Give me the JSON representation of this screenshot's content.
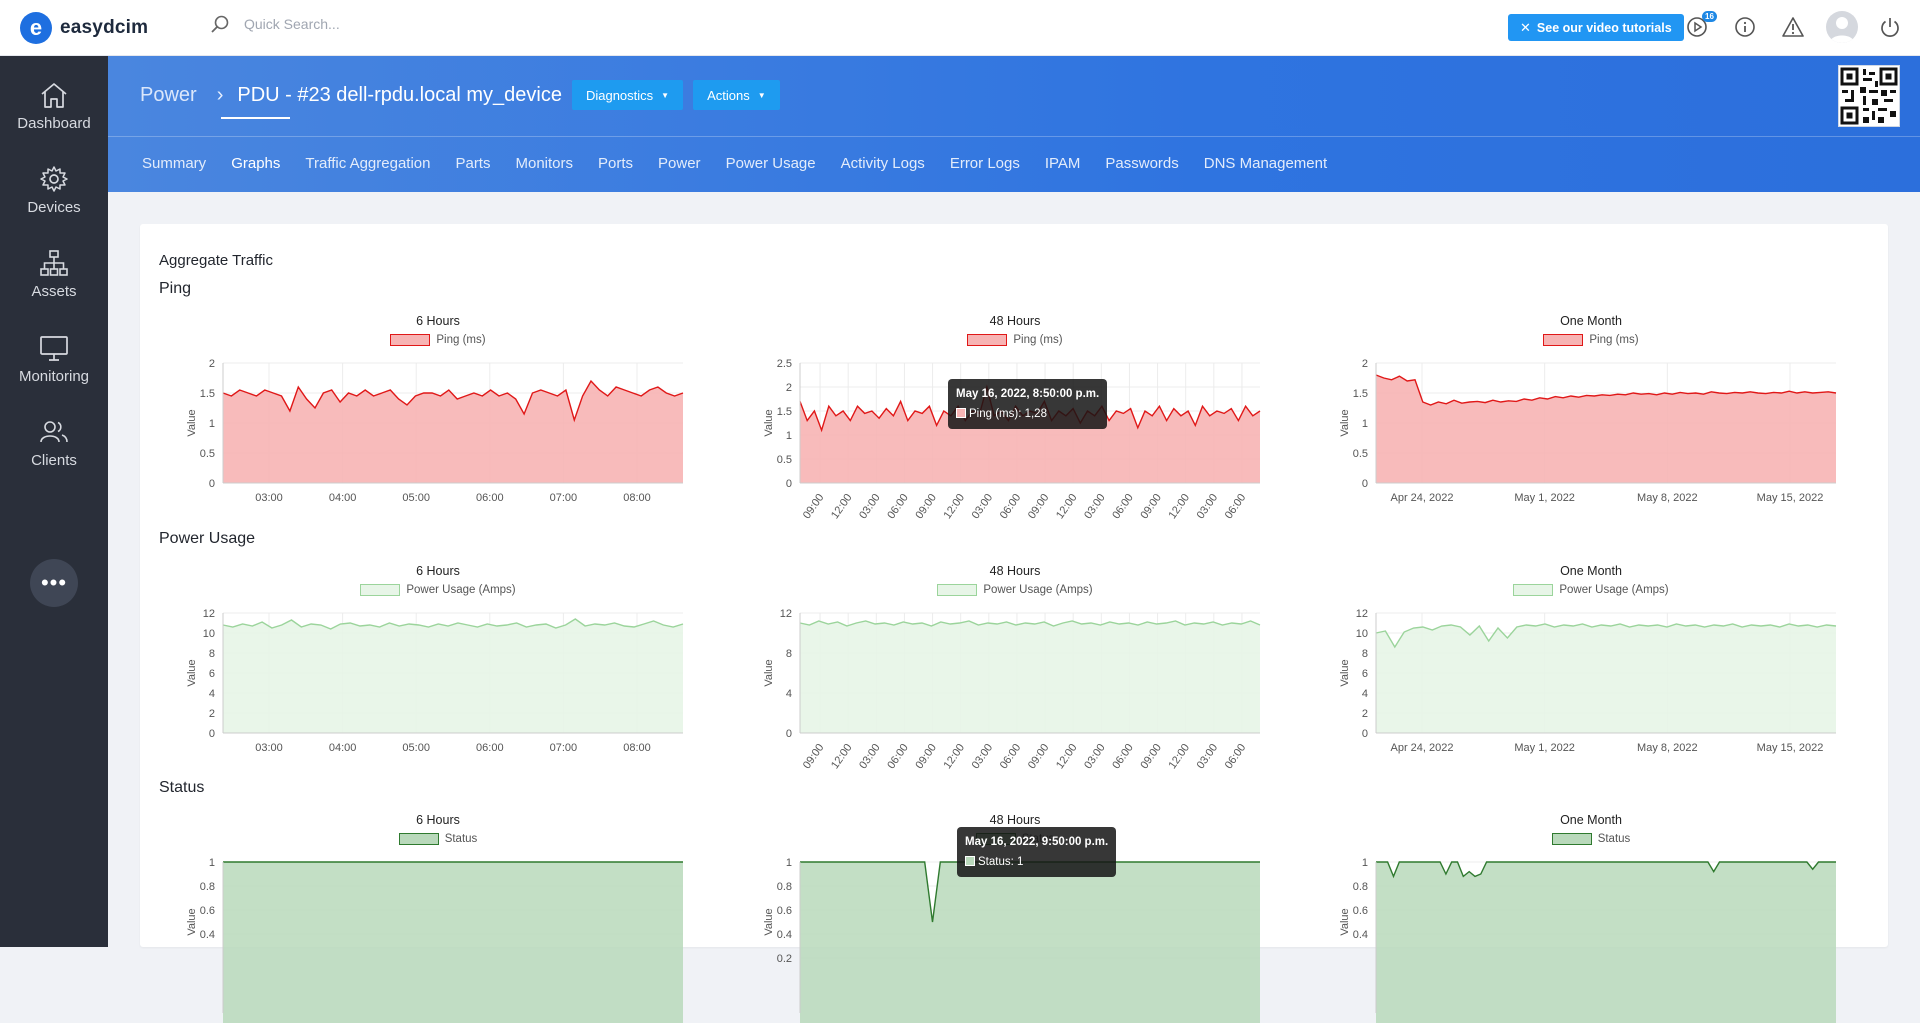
{
  "app": {
    "name": "easydcim"
  },
  "search": {
    "placeholder": "Quick Search..."
  },
  "topbar": {
    "tutorial_label": "See our video tutorials",
    "notification_count": "16"
  },
  "sidebar": {
    "items": [
      {
        "label": "Dashboard",
        "icon": "home-icon"
      },
      {
        "label": "Devices",
        "icon": "gear-icon"
      },
      {
        "label": "Assets",
        "icon": "sitemap-icon"
      },
      {
        "label": "Monitoring",
        "icon": "monitor-icon"
      },
      {
        "label": "Clients",
        "icon": "users-icon"
      }
    ],
    "more_label": "•••"
  },
  "header": {
    "breadcrumb_root": "Power",
    "title": "PDU - #23 dell-rpdu.local my_device",
    "diagnostics_label": "Diagnostics",
    "actions_label": "Actions",
    "tabs": [
      "Summary",
      "Graphs",
      "Traffic Aggregation",
      "Parts",
      "Monitors",
      "Ports",
      "Power",
      "Power Usage",
      "Activity Logs",
      "Error Logs",
      "IPAM",
      "Passwords",
      "DNS Management"
    ],
    "active_tab": "Graphs"
  },
  "content": {
    "aggregate_label": "Aggregate Traffic",
    "sections": [
      "Ping",
      "Power Usage",
      "Status"
    ]
  },
  "colors": {
    "ping_line": "#e01818",
    "ping_fill": "#f7b4b4",
    "power_line": "#9bd49b",
    "power_fill": "#e7f5e7",
    "status_line": "#2f7a2f",
    "status_fill": "#b9d9bb",
    "accent": "#2f74e0"
  },
  "chart_data": [
    {
      "type": "area",
      "section": "Ping",
      "title": "6 Hours",
      "series_name": "Ping (ms)",
      "ylabel": "Value",
      "ylim": [
        0,
        2
      ],
      "yticks": [
        "2",
        "1.5",
        "1",
        "0.5",
        "0"
      ],
      "xticks": [
        "03:00",
        "04:00",
        "05:00",
        "06:00",
        "07:00",
        "08:00"
      ],
      "values": [
        1.5,
        1.45,
        1.55,
        1.5,
        1.45,
        1.55,
        1.5,
        1.45,
        1.2,
        1.6,
        1.4,
        1.25,
        1.5,
        1.55,
        1.35,
        1.5,
        1.45,
        1.55,
        1.45,
        1.5,
        1.55,
        1.4,
        1.3,
        1.45,
        1.5,
        1.5,
        1.45,
        1.55,
        1.4,
        1.45,
        1.5,
        1.45,
        1.55,
        1.45,
        1.5,
        1.4,
        1.15,
        1.5,
        1.55,
        1.5,
        1.45,
        1.55,
        1.05,
        1.45,
        1.7,
        1.55,
        1.45,
        1.6,
        1.55,
        1.5,
        1.45,
        1.55,
        1.6,
        1.5,
        1.45,
        1.5
      ]
    },
    {
      "type": "area",
      "section": "Ping",
      "title": "48 Hours",
      "series_name": "Ping (ms)",
      "ylabel": "Value",
      "ylim": [
        0,
        2.5
      ],
      "yticks": [
        "2.5",
        "2",
        "1.5",
        "1",
        "0.5",
        "0"
      ],
      "xticks": [
        "09:00",
        "12:00",
        "03:00",
        "06:00",
        "09:00",
        "12:00",
        "03:00",
        "06:00",
        "09:00",
        "12:00",
        "03:00",
        "06:00",
        "09:00",
        "12:00",
        "03:00",
        "06:00"
      ],
      "values": [
        1.7,
        1.3,
        1.5,
        1.1,
        1.6,
        1.4,
        1.5,
        1.3,
        1.6,
        1.45,
        1.5,
        1.35,
        1.55,
        1.4,
        1.7,
        1.3,
        1.5,
        1.45,
        1.6,
        1.2,
        1.5,
        1.4,
        1.6,
        1.3,
        1.5,
        1.45,
        2.0,
        1.4,
        1.5,
        1.3,
        1.6,
        1.4,
        1.5,
        1.45,
        1.7,
        1.3,
        1.5,
        1.4,
        1.55,
        1.25,
        1.5,
        1.4,
        1.6,
        1.3,
        1.5,
        1.45,
        1.55,
        1.15,
        1.5,
        1.4,
        1.6,
        1.3,
        1.55,
        1.4,
        1.5,
        1.2,
        1.6,
        1.4,
        1.5,
        1.45,
        1.55,
        1.3,
        1.6,
        1.4,
        1.5
      ],
      "tooltip": {
        "date": "May 16, 2022, 8:50:00 p.m.",
        "text": "Ping (ms): 1,28"
      }
    },
    {
      "type": "area",
      "section": "Ping",
      "title": "One Month",
      "series_name": "Ping (ms)",
      "ylabel": "Value",
      "ylim": [
        0,
        2
      ],
      "yticks": [
        "2",
        "1.5",
        "1",
        "0.5",
        "0"
      ],
      "xticks": [
        "Apr 24, 2022",
        "May 1, 2022",
        "May 8, 2022",
        "May 15, 2022"
      ],
      "values": [
        1.8,
        1.75,
        1.72,
        1.78,
        1.7,
        1.72,
        1.35,
        1.3,
        1.35,
        1.32,
        1.38,
        1.33,
        1.35,
        1.36,
        1.34,
        1.38,
        1.35,
        1.37,
        1.36,
        1.4,
        1.38,
        1.42,
        1.4,
        1.44,
        1.42,
        1.45,
        1.43,
        1.46,
        1.45,
        1.47,
        1.46,
        1.48,
        1.47,
        1.5,
        1.48,
        1.49,
        1.47,
        1.5,
        1.48,
        1.51,
        1.49,
        1.5,
        1.48,
        1.52,
        1.5,
        1.49,
        1.51,
        1.5,
        1.52,
        1.5,
        1.49,
        1.51,
        1.5,
        1.53,
        1.5,
        1.52,
        1.5,
        1.51,
        1.52,
        1.5
      ]
    },
    {
      "type": "area",
      "section": "Power Usage",
      "title": "6 Hours",
      "series_name": "Power Usage (Amps)",
      "ylabel": "Value",
      "ylim": [
        0,
        12
      ],
      "yticks": [
        "12",
        "10",
        "8",
        "6",
        "4",
        "2",
        "0"
      ],
      "xticks": [
        "03:00",
        "04:00",
        "05:00",
        "06:00",
        "07:00",
        "08:00"
      ],
      "values": [
        10.8,
        10.6,
        10.9,
        10.7,
        11.1,
        10.5,
        10.8,
        11.3,
        10.6,
        10.9,
        10.8,
        10.4,
        10.9,
        11.0,
        10.7,
        10.8,
        10.6,
        11.0,
        10.7,
        10.9,
        10.8,
        10.6,
        10.9,
        10.7,
        11.0,
        10.8,
        10.6,
        10.9,
        10.7,
        10.8,
        11.0,
        10.6,
        10.8,
        10.9,
        10.5,
        10.8,
        11.4,
        10.7,
        10.9,
        10.8,
        11.0,
        10.7,
        10.6,
        10.9,
        11.2,
        10.8,
        10.6,
        10.9
      ]
    },
    {
      "type": "area",
      "section": "Power Usage",
      "title": "48 Hours",
      "series_name": "Power Usage (Amps)",
      "ylabel": "Value",
      "ylim": [
        0,
        12
      ],
      "yticks": [
        "12",
        "8",
        "4",
        "0"
      ],
      "xticks": [
        "09:00",
        "12:00",
        "03:00",
        "06:00",
        "09:00",
        "12:00",
        "03:00",
        "06:00",
        "09:00",
        "12:00",
        "03:00",
        "06:00",
        "09:00",
        "12:00",
        "03:00",
        "06:00"
      ],
      "values": [
        11.0,
        10.8,
        11.2,
        10.9,
        11.1,
        10.7,
        11.0,
        11.2,
        10.9,
        11.0,
        10.8,
        11.1,
        10.9,
        11.0,
        10.7,
        11.1,
        10.9,
        11.0,
        11.2,
        10.8,
        11.0,
        10.9,
        11.1,
        10.8,
        11.0,
        10.9,
        11.1,
        10.7,
        11.0,
        11.2,
        10.9,
        11.0,
        10.8,
        11.1,
        10.9,
        11.0,
        10.8,
        11.1,
        10.9,
        11.0,
        11.2,
        10.8,
        11.0,
        10.9,
        11.1,
        10.8,
        11.0,
        10.9,
        11.2,
        10.8
      ]
    },
    {
      "type": "area",
      "section": "Power Usage",
      "title": "One Month",
      "series_name": "Power Usage (Amps)",
      "ylabel": "Value",
      "ylim": [
        0,
        12
      ],
      "yticks": [
        "12",
        "10",
        "8",
        "6",
        "4",
        "2",
        "0"
      ],
      "xticks": [
        "Apr 24, 2022",
        "May 1, 2022",
        "May 8, 2022",
        "May 15, 2022"
      ],
      "values": [
        10.0,
        10.2,
        8.6,
        10.1,
        10.5,
        10.6,
        10.3,
        10.7,
        10.8,
        10.6,
        9.8,
        10.7,
        9.2,
        10.5,
        9.5,
        10.6,
        10.8,
        10.7,
        10.9,
        10.6,
        10.8,
        10.7,
        10.9,
        10.6,
        10.8,
        10.7,
        10.9,
        10.6,
        10.8,
        10.7,
        10.8,
        10.6,
        10.9,
        10.7,
        10.8,
        10.6,
        10.8,
        10.7,
        10.9,
        10.6,
        10.8,
        10.7,
        10.8,
        10.6,
        10.9,
        10.7,
        10.8,
        10.6,
        10.8,
        10.7
      ]
    },
    {
      "type": "area",
      "section": "Status",
      "title": "6 Hours",
      "series_name": "Status",
      "ylabel": "Value",
      "ylim": [
        0,
        1
      ],
      "yticks": [
        "1",
        "0.8",
        "0.6",
        "0.4"
      ],
      "values": [
        1,
        1,
        1,
        1,
        1,
        1,
        1,
        1,
        1,
        1,
        1,
        1,
        1,
        1,
        1,
        1,
        1,
        1,
        1,
        1
      ]
    },
    {
      "type": "area",
      "section": "Status",
      "title": "48 Hours",
      "series_name": "Status",
      "ylabel": "Value",
      "ylim": [
        0,
        1
      ],
      "yticks": [
        "1",
        "0.8",
        "0.6",
        "0.4",
        "0.2"
      ],
      "values": [
        1,
        1,
        1,
        1,
        1,
        1,
        1,
        1,
        1,
        1,
        1,
        1,
        1,
        1,
        1,
        1,
        1,
        0.5,
        1,
        1,
        1,
        1,
        1,
        1,
        1,
        1,
        1,
        1,
        1,
        1,
        1,
        1,
        1,
        1,
        1,
        1,
        1,
        1,
        1,
        1,
        1,
        1,
        1,
        1,
        1,
        1,
        1,
        1,
        1,
        1,
        1,
        1,
        1,
        1,
        1,
        1,
        1,
        1,
        1,
        1
      ],
      "tooltip": {
        "date": "May 16, 2022, 9:50:00 p.m.",
        "text": "Status: 1"
      }
    },
    {
      "type": "area",
      "section": "Status",
      "title": "One Month",
      "series_name": "Status",
      "ylabel": "Value",
      "ylim": [
        0,
        1
      ],
      "yticks": [
        "1",
        "0.8",
        "0.6",
        "0.4"
      ],
      "values": [
        1,
        1,
        1,
        0.88,
        1,
        1,
        1,
        1,
        1,
        1,
        1,
        1,
        0.9,
        1,
        1,
        0.88,
        0.92,
        0.88,
        0.9,
        1,
        1,
        1,
        1,
        1,
        1,
        1,
        1,
        1,
        1,
        1,
        1,
        1,
        1,
        1,
        1,
        1,
        1,
        1,
        1,
        1,
        1,
        1,
        1,
        1,
        1,
        1,
        1,
        1,
        1,
        1,
        1,
        1,
        1,
        1,
        1,
        1,
        1,
        1,
        0.92,
        1,
        1,
        1,
        1,
        1,
        1,
        1,
        1,
        1,
        1,
        1,
        1,
        1,
        1,
        1,
        1,
        0.94,
        1,
        1,
        1,
        1
      ]
    }
  ]
}
